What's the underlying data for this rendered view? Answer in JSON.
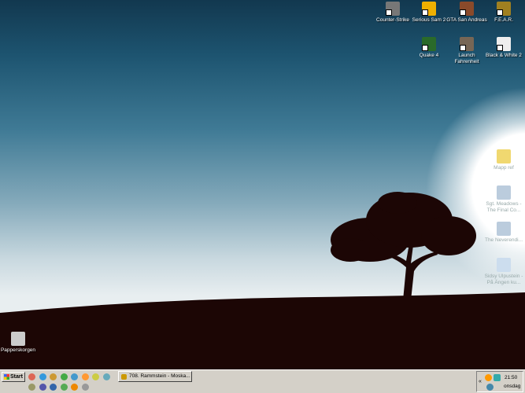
{
  "desktop_icons": [
    {
      "label": "Counter-Strike",
      "icon": "counter-strike-icon",
      "color": "#777"
    },
    {
      "label": "Serious Sam 2",
      "icon": "serious-sam-icon",
      "color": "#f0b000"
    },
    {
      "label": "GTA San Andreas",
      "icon": "gta-icon",
      "color": "#8a4a2a"
    },
    {
      "label": "F.E.A.R.",
      "icon": "fear-icon",
      "color": "#a08020"
    },
    {
      "label": "Quake 4",
      "icon": "quake-icon",
      "color": "#2a6a2a"
    },
    {
      "label": "Launch Fahrenheit",
      "icon": "fahrenheit-icon",
      "color": "#776655"
    },
    {
      "label": "Black & White 2",
      "icon": "black-white-icon",
      "color": "#eee"
    },
    {
      "label": "Mapp ref",
      "icon": "folder-icon",
      "color": "#f0d870"
    },
    {
      "label": "Sgt. Meadows - The Final Co...",
      "icon": "document-icon",
      "color": "#bcd"
    },
    {
      "label": "The Neverendi...",
      "icon": "document-icon",
      "color": "#bcd"
    },
    {
      "label": "Sidsy Ulpustein - På Ängen ku...",
      "icon": "media-file-icon",
      "color": "#cde"
    },
    {
      "label": "Papperskorgen",
      "icon": "recycle-bin-icon",
      "color": "#ccc"
    }
  ],
  "taskbar": {
    "start_label": "Start",
    "quick_launch": [
      "firefox-icon",
      "ie-icon",
      "winamp-icon",
      "chrome-icon",
      "notepad-icon",
      "messenger-icon",
      "media-icon",
      "pen-icon",
      "recycle-icon",
      "network-icon",
      "outlook-icon",
      "chat-icon",
      "vlc-icon",
      "drive-icon"
    ],
    "task_label": "708. Rammstein - Moska...",
    "clock": "21:50",
    "day": "onsdag",
    "tray_chevron": "«"
  }
}
